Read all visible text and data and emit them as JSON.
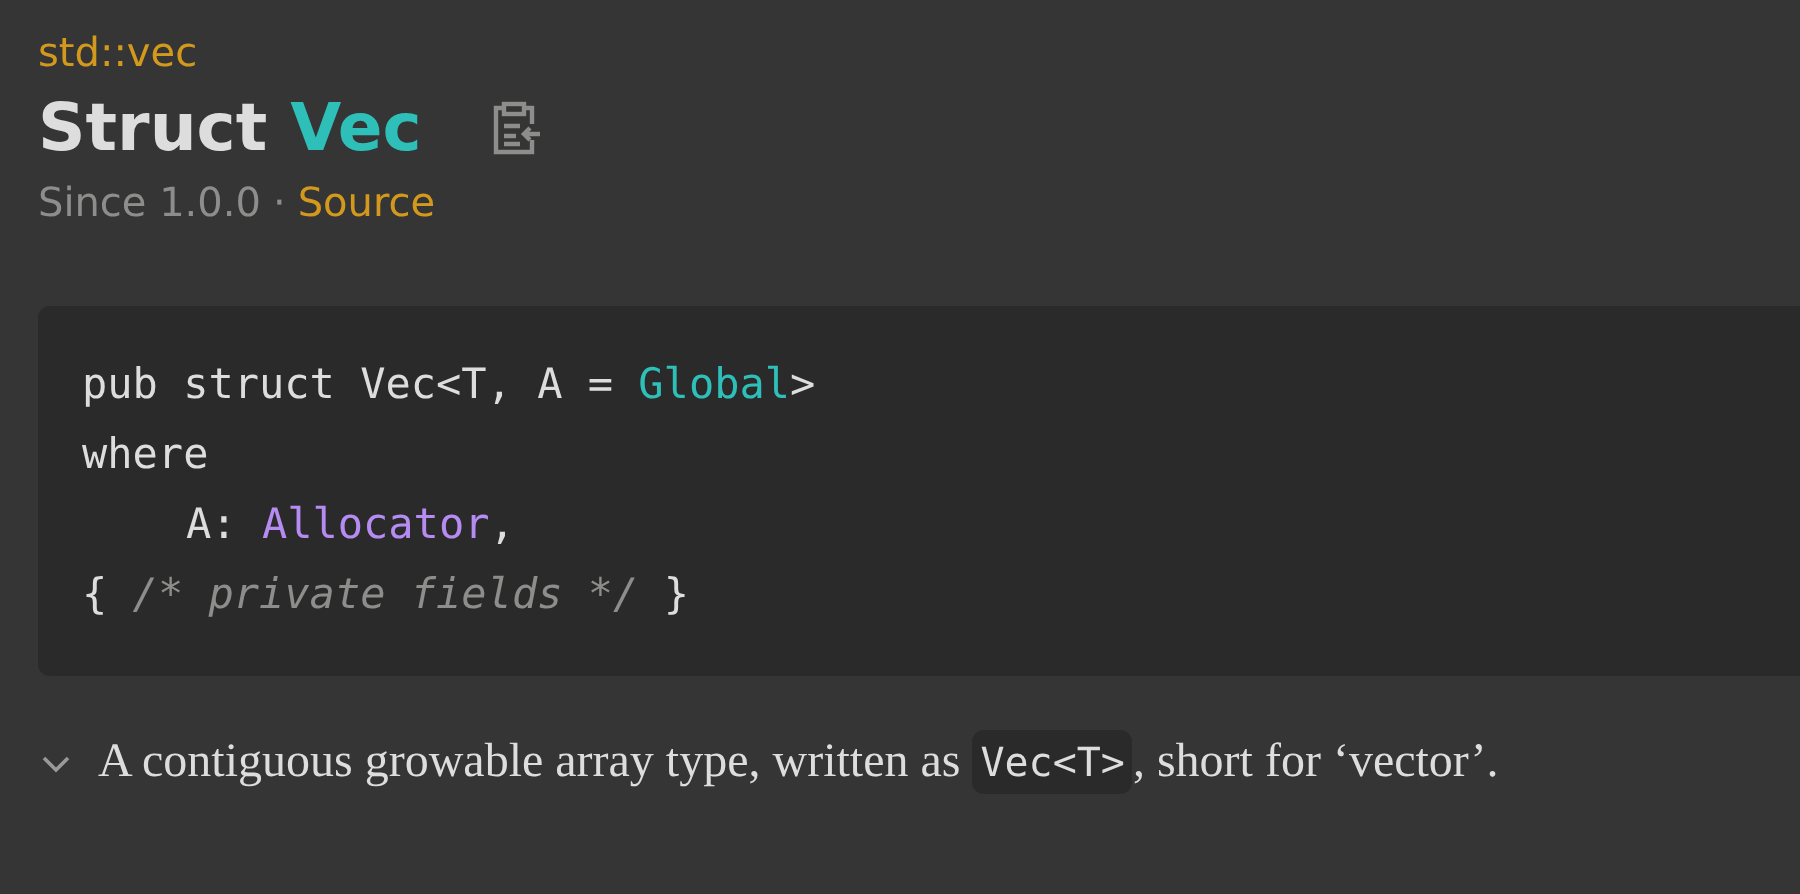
{
  "breadcrumb": "std::vec",
  "heading": {
    "kind_label": "Struct",
    "name": "Vec"
  },
  "meta": {
    "since": "Since 1.0.0",
    "separator": "·",
    "source_link": "Source"
  },
  "code_block": {
    "lines": [
      {
        "indent": false,
        "tokens": [
          {
            "kind": "plain",
            "text": "pub struct Vec<T, A = "
          },
          {
            "kind": "type",
            "text": "Global"
          },
          {
            "kind": "plain",
            "text": ">"
          }
        ]
      },
      {
        "indent": false,
        "tokens": [
          {
            "kind": "plain",
            "text": "where"
          }
        ]
      },
      {
        "indent": true,
        "tokens": [
          {
            "kind": "plain",
            "text": "A: "
          },
          {
            "kind": "trait",
            "text": "Allocator"
          },
          {
            "kind": "plain",
            "text": ","
          }
        ]
      },
      {
        "indent": false,
        "tokens": [
          {
            "kind": "plain",
            "text": "{ "
          },
          {
            "kind": "comment",
            "text": "/* private fields */"
          },
          {
            "kind": "plain",
            "text": " }"
          }
        ]
      }
    ]
  },
  "description": {
    "expanded": true,
    "parts": [
      {
        "kind": "text",
        "text": "A contiguous growable array type, written as "
      },
      {
        "kind": "code",
        "text": "Vec<T>"
      },
      {
        "kind": "text",
        "text": ", short for ‘vector’."
      }
    ]
  }
}
